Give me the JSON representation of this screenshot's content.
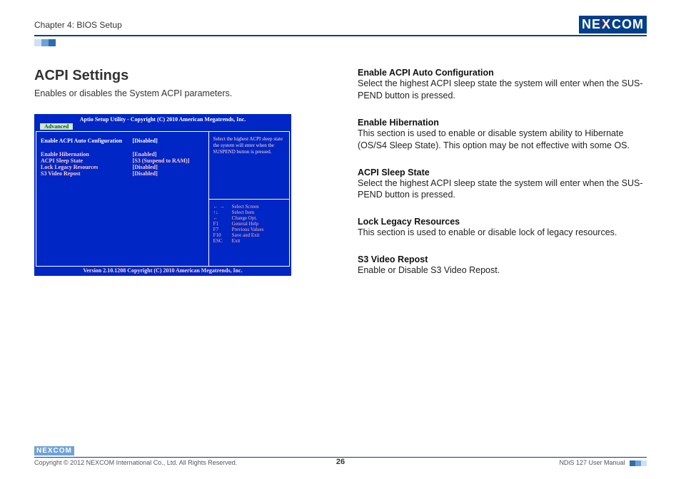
{
  "header": {
    "chapter": "Chapter 4: BIOS Setup",
    "logo_text_left": "NE",
    "logo_text_x": "X",
    "logo_text_right": "COM"
  },
  "left": {
    "title": "ACPI Settings",
    "subtitle": "Enables or disables the System ACPI parameters."
  },
  "bios": {
    "title": "Aptio  Setup  Utility - Copyright (C) 2010 American Megatrends, Inc.",
    "tab": "Advanced",
    "rows": [
      {
        "label": "Enable ACPI Auto Configuration",
        "value": "[Disabled]",
        "active": true
      },
      {
        "label": "",
        "value": "",
        "active": false
      },
      {
        "label": "Enable Hibernation",
        "value": "[Enabled]",
        "active": false
      },
      {
        "label": "ACPI Sleep State",
        "value": "[S3 (Suspend to RAM)]",
        "active": false
      },
      {
        "label": "Lock Legacy Resources",
        "value": "[Disabled]",
        "active": false
      },
      {
        "label": "S3 Video Repost",
        "value": "[Disabled]",
        "active": false
      }
    ],
    "help": "Select the highest ACPI sleep state the system will enter when the SUSPEND button is pressed.",
    "legend": [
      {
        "k": "← →",
        "v": "Select Screen"
      },
      {
        "k": "↑↓",
        "v": "Select Item"
      },
      {
        "k": "←",
        "v": "Change Opt."
      },
      {
        "k": "F1",
        "v": "General Help"
      },
      {
        "k": "F7",
        "v": "Previous Values"
      },
      {
        "k": "F10",
        "v": "Save and Exit"
      },
      {
        "k": "ESC",
        "v": "Exit"
      }
    ],
    "footer": "Version 2.10.1208 Copyright (C) 2010 American Megatrends, Inc."
  },
  "right": {
    "sections": [
      {
        "h": "Enable ACPI Auto Configuration",
        "p": "Select the highest ACPI sleep state the system will enter when the SUS-PEND button is pressed."
      },
      {
        "h": "Enable Hibernation",
        "p": "This section is used to enable or disable system ability to Hibernate (OS/S4 Sleep State). This option may be not effective with some OS."
      },
      {
        "h": "ACPI Sleep State",
        "p": "Select the highest ACPI sleep state the system will enter when the SUS-PEND button is pressed."
      },
      {
        "h": "Lock Legacy Resources",
        "p": "This section is used to enable or disable lock of legacy resources."
      },
      {
        "h": "S3 Video Repost",
        "p": "Enable or Disable S3 Video Repost."
      }
    ]
  },
  "footer": {
    "logo": "NEXCOM",
    "copyright": "Copyright © 2012 NEXCOM International Co., Ltd. All Rights Reserved.",
    "manual": "NDiS 127 User Manual",
    "page": "26"
  }
}
